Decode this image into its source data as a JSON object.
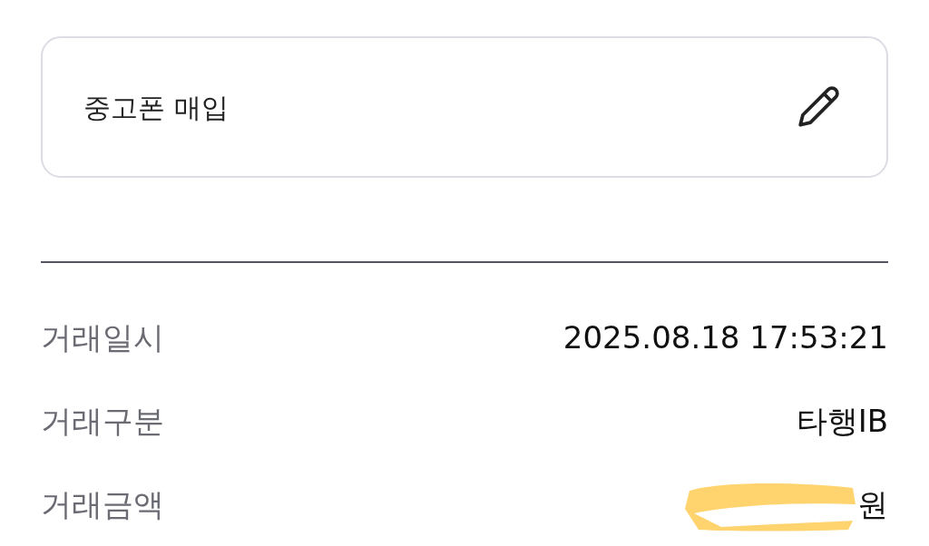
{
  "memo_card": {
    "text": "중고폰 매입"
  },
  "details": [
    {
      "label": "거래일시",
      "value": "2025.08.18 17:53:21",
      "redacted": false
    },
    {
      "label": "거래구분",
      "value": "타행IB",
      "redacted": false
    },
    {
      "label": "거래금액",
      "value": "원",
      "redacted": true
    }
  ]
}
